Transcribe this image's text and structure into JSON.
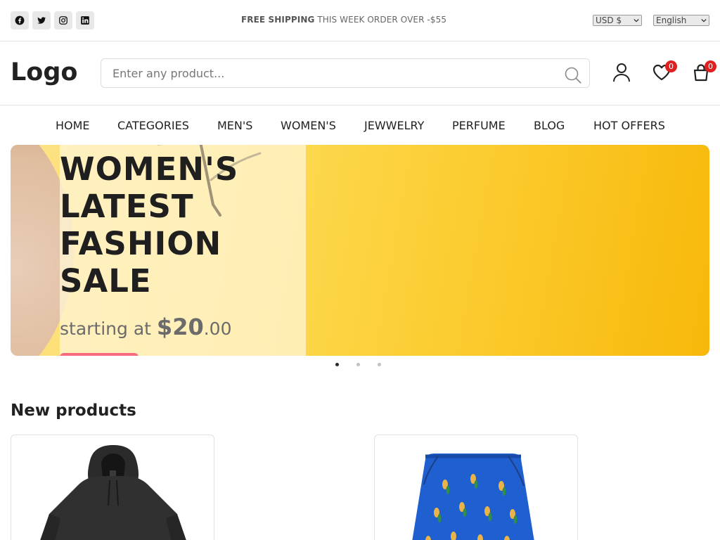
{
  "topbar": {
    "social": [
      "facebook-icon",
      "twitter-icon",
      "instagram-icon",
      "linkedin-icon"
    ],
    "shipping_bold": "FREE SHIPPING",
    "shipping_text": "THIS WEEK ORDER OVER -$55",
    "currency": "USD $",
    "language": "English"
  },
  "header": {
    "logo": "Logo",
    "search_placeholder": "Enter any product...",
    "wishlist_count": "0",
    "cart_count": "0"
  },
  "nav": {
    "items": [
      "HOME",
      "CATEGORIES",
      "MEN'S",
      "WOMEN'S",
      "JEWWELRY",
      "PERFUME",
      "BLOG",
      "HOT OFFERS"
    ]
  },
  "banner": {
    "title": "WOMEN'S LATEST FASHION SALE",
    "price_prefix": "starting at",
    "price_amount": "$20",
    "price_cents": ".00"
  },
  "carousel": {
    "slides": 3,
    "active": 1
  },
  "products": {
    "section_title": "New products",
    "items": [
      {
        "image": "black-hoodie"
      },
      {
        "image": "blue-skirt"
      }
    ]
  },
  "colors": {
    "badge": "#e02020",
    "banner_bg": "#fcd74a",
    "shop_button": "#f46c7e"
  }
}
